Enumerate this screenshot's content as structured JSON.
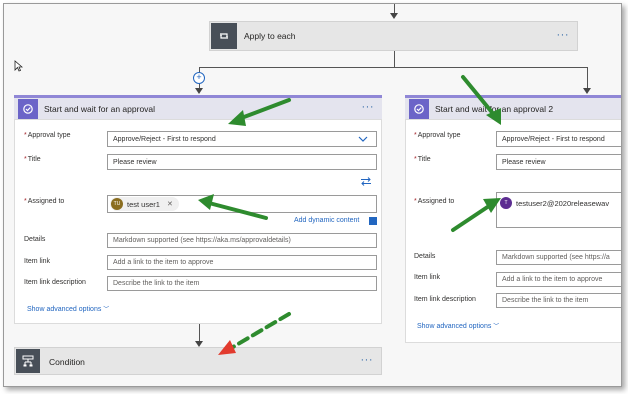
{
  "apply_each": {
    "title": "Apply to each",
    "more": "···"
  },
  "left_card": {
    "title": "Start and wait for an approval",
    "more": "···",
    "approval_type_label": "Approval type",
    "approval_type_value": "Approve/Reject - First to respond",
    "title_label": "Title",
    "title_value": "Please review",
    "assigned_label": "Assigned to",
    "assignee": {
      "initials": "TU",
      "name": "test user1",
      "remove": "✕"
    },
    "add_dynamic": "Add dynamic content",
    "details_label": "Details",
    "details_placeholder": "Markdown supported (see https://aka.ms/approvaldetails)",
    "item_link_label": "Item link",
    "item_link_placeholder": "Add a link to the item to approve",
    "item_link_desc_label": "Item link description",
    "item_link_desc_placeholder": "Describe the link to the item",
    "advanced": "Show advanced options"
  },
  "right_card": {
    "title": "Start and wait for an approval 2",
    "approval_type_label": "Approval type",
    "approval_type_value": "Approve/Reject - First to respond",
    "title_label": "Title",
    "title_value": "Please review",
    "assigned_label": "Assigned to",
    "assignee": {
      "initials": "T",
      "name": "testuser2@2020releasewav"
    },
    "details_label": "Details",
    "details_placeholder": "Markdown supported (see https://a",
    "item_link_label": "Item link",
    "item_link_placeholder": "Add a link to the item to approve",
    "item_link_desc_label": "Item link description",
    "item_link_desc_placeholder": "Describe the link to the item",
    "advanced": "Show advanced options"
  },
  "condition": {
    "title": "Condition",
    "more": "···"
  },
  "colors": {
    "accent": "#6b64c8",
    "condition": "#484f58",
    "link": "#2266c0",
    "annotation_green": "#2e8b2e",
    "annotation_red": "#e23b2e"
  }
}
